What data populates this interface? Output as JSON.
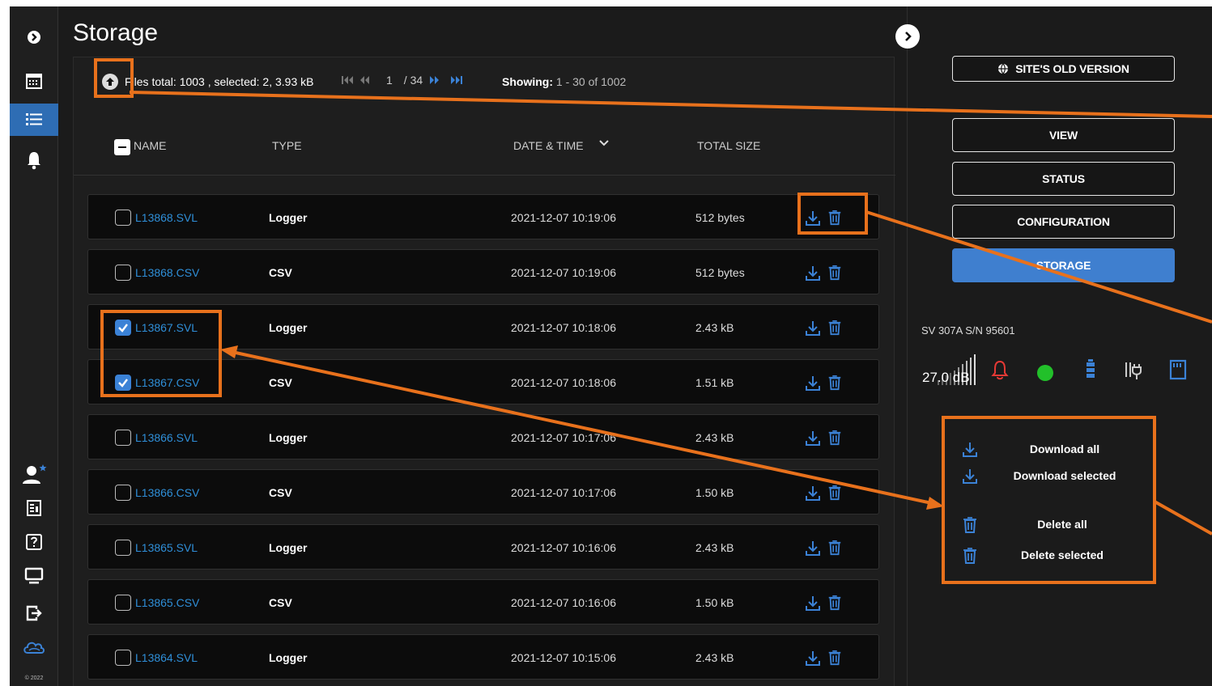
{
  "page": {
    "title": "Storage",
    "copyright": "© 2022"
  },
  "toolbar": {
    "files_total": "Files total: 1003 , selected: 2, 3.93 kB",
    "page_current": "1",
    "page_total": "/ 34",
    "showing_label": "Showing:",
    "showing_value": "1 - 30 of 1002"
  },
  "table": {
    "columns": {
      "name": "NAME",
      "type": "TYPE",
      "datetime": "DATE & TIME",
      "size": "TOTAL SIZE"
    },
    "rows": [
      {
        "name": "L13868.SVL",
        "type": "Logger",
        "datetime": "2021-12-07 10:19:06",
        "size": "512 bytes",
        "checked": false
      },
      {
        "name": "L13868.CSV",
        "type": "CSV",
        "datetime": "2021-12-07 10:19:06",
        "size": "512 bytes",
        "checked": false
      },
      {
        "name": "L13867.SVL",
        "type": "Logger",
        "datetime": "2021-12-07 10:18:06",
        "size": "2.43 kB",
        "checked": true
      },
      {
        "name": "L13867.CSV",
        "type": "CSV",
        "datetime": "2021-12-07 10:18:06",
        "size": "1.51 kB",
        "checked": true
      },
      {
        "name": "L13866.SVL",
        "type": "Logger",
        "datetime": "2021-12-07 10:17:06",
        "size": "2.43 kB",
        "checked": false
      },
      {
        "name": "L13866.CSV",
        "type": "CSV",
        "datetime": "2021-12-07 10:17:06",
        "size": "1.50 kB",
        "checked": false
      },
      {
        "name": "L13865.SVL",
        "type": "Logger",
        "datetime": "2021-12-07 10:16:06",
        "size": "2.43 kB",
        "checked": false
      },
      {
        "name": "L13865.CSV",
        "type": "CSV",
        "datetime": "2021-12-07 10:16:06",
        "size": "1.50 kB",
        "checked": false
      },
      {
        "name": "L13864.SVL",
        "type": "Logger",
        "datetime": "2021-12-07 10:15:06",
        "size": "2.43 kB",
        "checked": false
      }
    ]
  },
  "right": {
    "old_version": "SITE'S OLD VERSION",
    "nav": {
      "view": "VIEW",
      "status": "STATUS",
      "configuration": "CONFIGURATION",
      "storage": "STORAGE"
    },
    "device": "SV 307A S/N 95601",
    "db": "27.0 dB",
    "actions": {
      "download_all": "Download all",
      "download_selected": "Download selected",
      "delete_all": "Delete all",
      "delete_selected": "Delete selected"
    }
  },
  "colors": {
    "accent": "#3f7fcf",
    "link": "#2f8fd8",
    "annotation": "#e8711c",
    "status_ok": "#22c02a",
    "alarm": "#e53935"
  }
}
